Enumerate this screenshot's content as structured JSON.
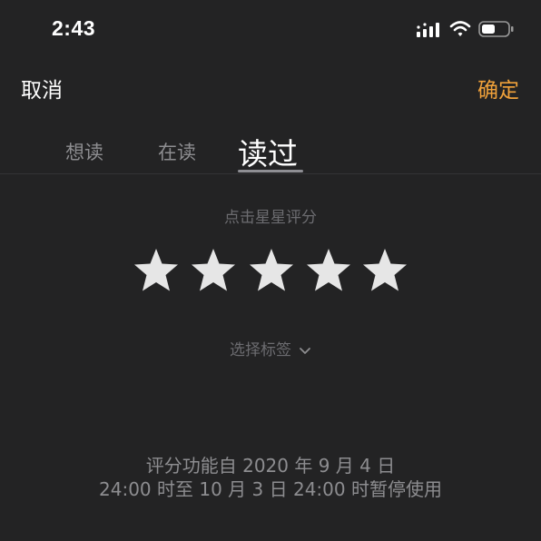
{
  "status_bar": {
    "time": "2:43"
  },
  "nav": {
    "cancel_label": "取消",
    "confirm_label": "确定"
  },
  "tabs": [
    {
      "label": "想读",
      "selected": false
    },
    {
      "label": "在读",
      "selected": false
    },
    {
      "label": "读过",
      "selected": true
    }
  ],
  "rating": {
    "hint": "点击星星评分",
    "max_stars": 5,
    "filled_stars": 0,
    "star_color": "#e6e6e6"
  },
  "tag_selector": {
    "label": "选择标签"
  },
  "notice": {
    "line1": "评分功能自 2020 年 9 月 4 日",
    "line2": "24:00 时至 10 月 3 日 24:00 时暂停使用"
  },
  "colors": {
    "accent": "#f0a13a",
    "background": "#232324"
  }
}
